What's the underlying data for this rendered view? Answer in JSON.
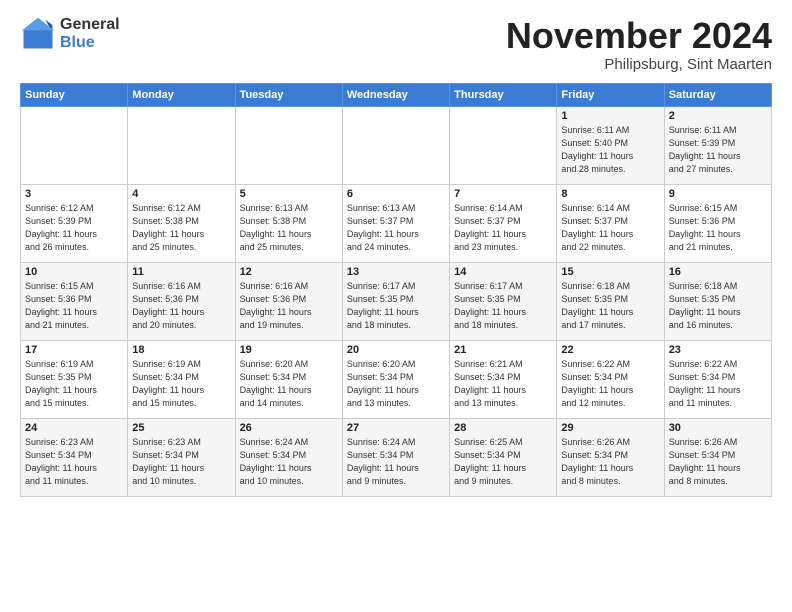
{
  "header": {
    "logo_general": "General",
    "logo_blue": "Blue",
    "month_title": "November 2024",
    "subtitle": "Philipsburg, Sint Maarten"
  },
  "weekdays": [
    "Sunday",
    "Monday",
    "Tuesday",
    "Wednesday",
    "Thursday",
    "Friday",
    "Saturday"
  ],
  "weeks": [
    [
      {
        "day": "",
        "info": ""
      },
      {
        "day": "",
        "info": ""
      },
      {
        "day": "",
        "info": ""
      },
      {
        "day": "",
        "info": ""
      },
      {
        "day": "",
        "info": ""
      },
      {
        "day": "1",
        "info": "Sunrise: 6:11 AM\nSunset: 5:40 PM\nDaylight: 11 hours\nand 28 minutes."
      },
      {
        "day": "2",
        "info": "Sunrise: 6:11 AM\nSunset: 5:39 PM\nDaylight: 11 hours\nand 27 minutes."
      }
    ],
    [
      {
        "day": "3",
        "info": "Sunrise: 6:12 AM\nSunset: 5:39 PM\nDaylight: 11 hours\nand 26 minutes."
      },
      {
        "day": "4",
        "info": "Sunrise: 6:12 AM\nSunset: 5:38 PM\nDaylight: 11 hours\nand 25 minutes."
      },
      {
        "day": "5",
        "info": "Sunrise: 6:13 AM\nSunset: 5:38 PM\nDaylight: 11 hours\nand 25 minutes."
      },
      {
        "day": "6",
        "info": "Sunrise: 6:13 AM\nSunset: 5:37 PM\nDaylight: 11 hours\nand 24 minutes."
      },
      {
        "day": "7",
        "info": "Sunrise: 6:14 AM\nSunset: 5:37 PM\nDaylight: 11 hours\nand 23 minutes."
      },
      {
        "day": "8",
        "info": "Sunrise: 6:14 AM\nSunset: 5:37 PM\nDaylight: 11 hours\nand 22 minutes."
      },
      {
        "day": "9",
        "info": "Sunrise: 6:15 AM\nSunset: 5:36 PM\nDaylight: 11 hours\nand 21 minutes."
      }
    ],
    [
      {
        "day": "10",
        "info": "Sunrise: 6:15 AM\nSunset: 5:36 PM\nDaylight: 11 hours\nand 21 minutes."
      },
      {
        "day": "11",
        "info": "Sunrise: 6:16 AM\nSunset: 5:36 PM\nDaylight: 11 hours\nand 20 minutes."
      },
      {
        "day": "12",
        "info": "Sunrise: 6:16 AM\nSunset: 5:36 PM\nDaylight: 11 hours\nand 19 minutes."
      },
      {
        "day": "13",
        "info": "Sunrise: 6:17 AM\nSunset: 5:35 PM\nDaylight: 11 hours\nand 18 minutes."
      },
      {
        "day": "14",
        "info": "Sunrise: 6:17 AM\nSunset: 5:35 PM\nDaylight: 11 hours\nand 18 minutes."
      },
      {
        "day": "15",
        "info": "Sunrise: 6:18 AM\nSunset: 5:35 PM\nDaylight: 11 hours\nand 17 minutes."
      },
      {
        "day": "16",
        "info": "Sunrise: 6:18 AM\nSunset: 5:35 PM\nDaylight: 11 hours\nand 16 minutes."
      }
    ],
    [
      {
        "day": "17",
        "info": "Sunrise: 6:19 AM\nSunset: 5:35 PM\nDaylight: 11 hours\nand 15 minutes."
      },
      {
        "day": "18",
        "info": "Sunrise: 6:19 AM\nSunset: 5:34 PM\nDaylight: 11 hours\nand 15 minutes."
      },
      {
        "day": "19",
        "info": "Sunrise: 6:20 AM\nSunset: 5:34 PM\nDaylight: 11 hours\nand 14 minutes."
      },
      {
        "day": "20",
        "info": "Sunrise: 6:20 AM\nSunset: 5:34 PM\nDaylight: 11 hours\nand 13 minutes."
      },
      {
        "day": "21",
        "info": "Sunrise: 6:21 AM\nSunset: 5:34 PM\nDaylight: 11 hours\nand 13 minutes."
      },
      {
        "day": "22",
        "info": "Sunrise: 6:22 AM\nSunset: 5:34 PM\nDaylight: 11 hours\nand 12 minutes."
      },
      {
        "day": "23",
        "info": "Sunrise: 6:22 AM\nSunset: 5:34 PM\nDaylight: 11 hours\nand 11 minutes."
      }
    ],
    [
      {
        "day": "24",
        "info": "Sunrise: 6:23 AM\nSunset: 5:34 PM\nDaylight: 11 hours\nand 11 minutes."
      },
      {
        "day": "25",
        "info": "Sunrise: 6:23 AM\nSunset: 5:34 PM\nDaylight: 11 hours\nand 10 minutes."
      },
      {
        "day": "26",
        "info": "Sunrise: 6:24 AM\nSunset: 5:34 PM\nDaylight: 11 hours\nand 10 minutes."
      },
      {
        "day": "27",
        "info": "Sunrise: 6:24 AM\nSunset: 5:34 PM\nDaylight: 11 hours\nand 9 minutes."
      },
      {
        "day": "28",
        "info": "Sunrise: 6:25 AM\nSunset: 5:34 PM\nDaylight: 11 hours\nand 9 minutes."
      },
      {
        "day": "29",
        "info": "Sunrise: 6:26 AM\nSunset: 5:34 PM\nDaylight: 11 hours\nand 8 minutes."
      },
      {
        "day": "30",
        "info": "Sunrise: 6:26 AM\nSunset: 5:34 PM\nDaylight: 11 hours\nand 8 minutes."
      }
    ]
  ]
}
